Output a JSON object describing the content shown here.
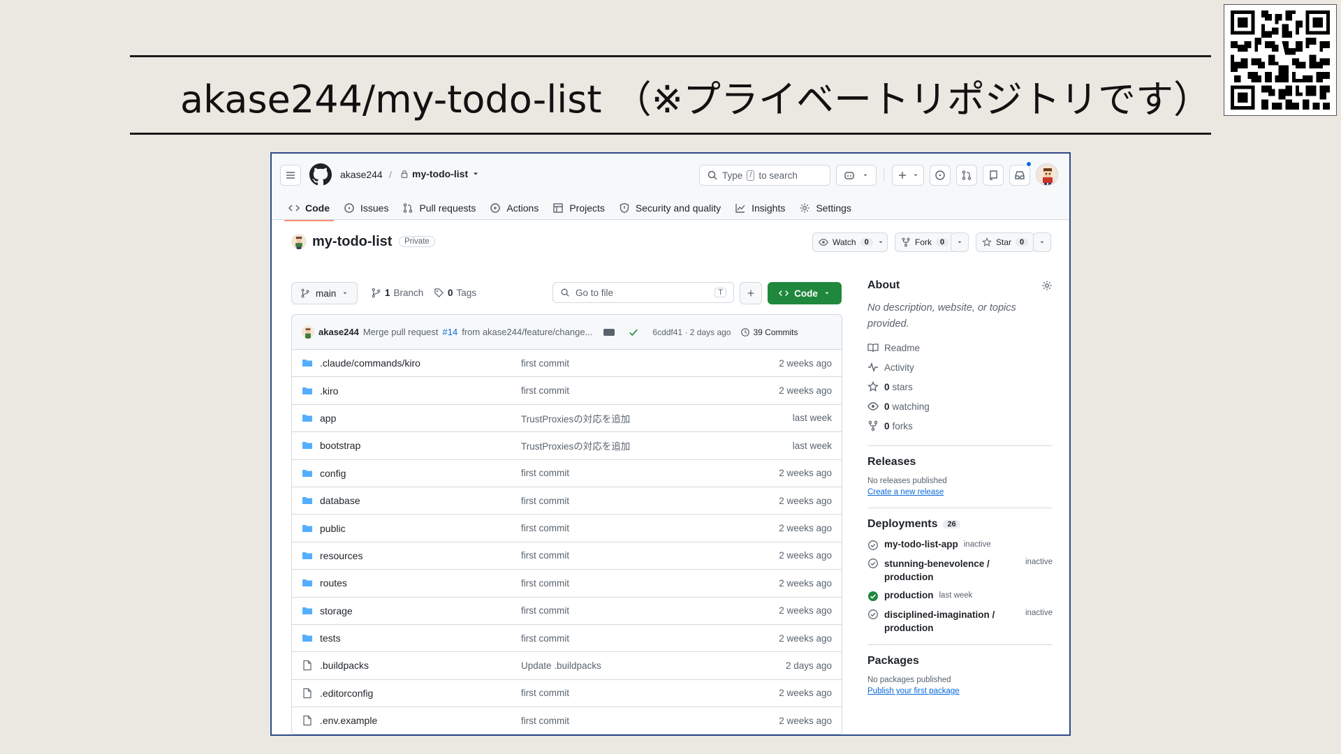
{
  "slide": {
    "title": "akase244/my-todo-list （※プライベートリポジトリです）"
  },
  "header": {
    "owner": "akase244",
    "separator": "/",
    "repo": "my-todo-list",
    "search_label": "Type",
    "search_key": "/",
    "search_suffix": "to search"
  },
  "tabs": [
    {
      "label": "Code",
      "icon": "code-icon"
    },
    {
      "label": "Issues",
      "icon": "issue-icon"
    },
    {
      "label": "Pull requests",
      "icon": "pull-request-icon"
    },
    {
      "label": "Actions",
      "icon": "play-icon"
    },
    {
      "label": "Projects",
      "icon": "table-icon"
    },
    {
      "label": "Security and quality",
      "icon": "shield-icon"
    },
    {
      "label": "Insights",
      "icon": "graph-icon"
    },
    {
      "label": "Settings",
      "icon": "gear-icon"
    }
  ],
  "repo_head": {
    "name": "my-todo-list",
    "visibility": "Private",
    "watch_label": "Watch",
    "watch_count": "0",
    "fork_label": "Fork",
    "fork_count": "0",
    "star_label": "Star",
    "star_count": "0"
  },
  "toolbar": {
    "branch": "main",
    "branch_count": "1",
    "branch_label": "Branch",
    "tag_count": "0",
    "tag_label": "Tags",
    "goto_placeholder": "Go to file",
    "goto_key": "T",
    "code_label": "Code"
  },
  "latest_commit": {
    "author": "akase244",
    "message_prefix": "Merge pull request",
    "pr": "#14",
    "message_suffix": "from akase244/feature/change...",
    "sha_time": "6cddf41 · 2 days ago",
    "commits": "39 Commits"
  },
  "files": [
    {
      "name": ".claude/commands/kiro",
      "type": "folder",
      "message": "first commit",
      "date": "2 weeks ago"
    },
    {
      "name": ".kiro",
      "type": "folder",
      "message": "first commit",
      "date": "2 weeks ago"
    },
    {
      "name": "app",
      "type": "folder",
      "message": "TrustProxiesの対応を追加",
      "date": "last week"
    },
    {
      "name": "bootstrap",
      "type": "folder",
      "message": "TrustProxiesの対応を追加",
      "date": "last week"
    },
    {
      "name": "config",
      "type": "folder",
      "message": "first commit",
      "date": "2 weeks ago"
    },
    {
      "name": "database",
      "type": "folder",
      "message": "first commit",
      "date": "2 weeks ago"
    },
    {
      "name": "public",
      "type": "folder",
      "message": "first commit",
      "date": "2 weeks ago"
    },
    {
      "name": "resources",
      "type": "folder",
      "message": "first commit",
      "date": "2 weeks ago"
    },
    {
      "name": "routes",
      "type": "folder",
      "message": "first commit",
      "date": "2 weeks ago"
    },
    {
      "name": "storage",
      "type": "folder",
      "message": "first commit",
      "date": "2 weeks ago"
    },
    {
      "name": "tests",
      "type": "folder",
      "message": "first commit",
      "date": "2 weeks ago"
    },
    {
      "name": ".buildpacks",
      "type": "file",
      "message": "Update .buildpacks",
      "date": "2 days ago"
    },
    {
      "name": ".editorconfig",
      "type": "file",
      "message": "first commit",
      "date": "2 weeks ago"
    },
    {
      "name": ".env.example",
      "type": "file",
      "message": "first commit",
      "date": "2 weeks ago"
    }
  ],
  "about": {
    "title": "About",
    "description": "No description, website, or topics provided.",
    "readme": "Readme",
    "activity": "Activity",
    "stars_count": "0",
    "stars_label": "stars",
    "watching_count": "0",
    "watching_label": "watching",
    "forks_count": "0",
    "forks_label": "forks"
  },
  "releases": {
    "title": "Releases",
    "empty": "No releases published",
    "link": "Create a new release"
  },
  "deployments": {
    "title": "Deployments",
    "count": "26",
    "items": [
      {
        "name": "my-todo-list-app",
        "status": "inactive",
        "active": false
      },
      {
        "name": "stunning-benevolence / production",
        "status": "inactive",
        "active": false
      },
      {
        "name": "production",
        "status": "last week",
        "active": true
      },
      {
        "name": "disciplined-imagination / production",
        "status": "inactive",
        "active": false
      }
    ]
  },
  "packages": {
    "title": "Packages",
    "empty": "No packages published",
    "link": "Publish your first package"
  },
  "colors": {
    "folder": "#54aeff",
    "accent_green": "#1f883d",
    "link": "#0969da",
    "tab_underline": "#fd8c73"
  }
}
